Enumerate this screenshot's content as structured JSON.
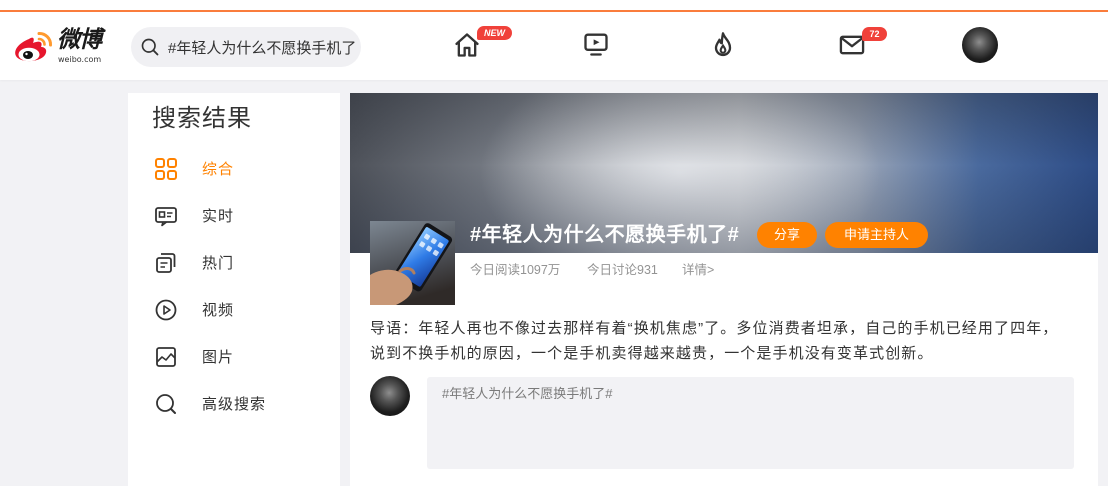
{
  "header": {
    "logo": {
      "icon": "weibo-logo-icon",
      "text": "微博",
      "subtext": "weibo.com"
    },
    "search": {
      "icon": "search-icon",
      "value": "#年轻人为什么不愿换手机了"
    },
    "nav": [
      {
        "icon": "home-icon",
        "badge": "NEW"
      },
      {
        "icon": "tv-video-icon"
      },
      {
        "icon": "fire-hot-icon"
      },
      {
        "icon": "mail-icon",
        "badge": "72"
      }
    ]
  },
  "sidebar": {
    "title": "搜索结果",
    "items": [
      {
        "icon": "grid-icon",
        "label": "综合",
        "active": true
      },
      {
        "icon": "realtime-icon",
        "label": "实时",
        "active": false
      },
      {
        "icon": "hot-pages-icon",
        "label": "热门",
        "active": false
      },
      {
        "icon": "play-circle-icon",
        "label": "视频",
        "active": false
      },
      {
        "icon": "image-icon",
        "label": "图片",
        "active": false
      },
      {
        "icon": "search-icon",
        "label": "高级搜索",
        "active": false
      }
    ]
  },
  "topic": {
    "title": "#年轻人为什么不愿换手机了#",
    "share_label": "分享",
    "apply_host_label": "申请主持人",
    "stats": {
      "reads": "今日阅读1097万",
      "discussions": "今日讨论931",
      "details_link": "详情>"
    },
    "intro": [
      "导语：年轻人再也不像过去那样有着“换机焦虑”了。多位消费者坦承，自己的手机已经用了四年，",
      "说到不换手机的原因，一个是手机卖得越来越贵，一个是手机没有变革式创新。"
    ]
  },
  "composer": {
    "placeholder": "#年轻人为什么不愿换手机了#"
  },
  "colors": {
    "accent": "#ff8200",
    "top_bar": "#fa7d3c",
    "badge": "#f0413a",
    "page_bg": "#f2f2f5"
  }
}
